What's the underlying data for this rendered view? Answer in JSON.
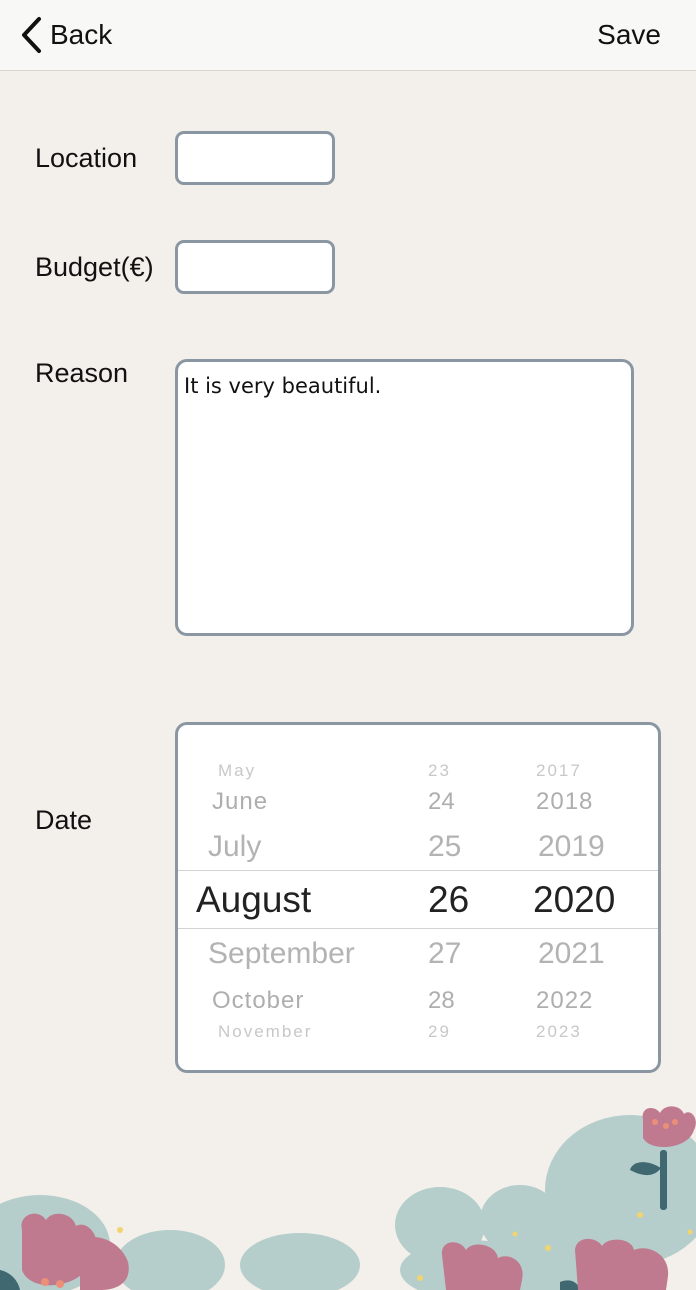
{
  "nav": {
    "back_label": "Back",
    "save_label": "Save"
  },
  "form": {
    "location_label": "Location",
    "location_value": "",
    "budget_label": "Budget(€)",
    "budget_value": "",
    "reason_label": "Reason",
    "reason_value": "It is very beautiful.",
    "date_label": "Date"
  },
  "date_picker": {
    "months": [
      "May",
      "June",
      "July",
      "August",
      "September",
      "October",
      "November"
    ],
    "days": [
      "23",
      "24",
      "25",
      "26",
      "27",
      "28",
      "29"
    ],
    "years": [
      "2017",
      "2018",
      "2019",
      "2020",
      "2021",
      "2022",
      "2023"
    ],
    "selected": {
      "month": "August",
      "day": "26",
      "year": "2020"
    }
  },
  "colors": {
    "background": "#f3efea",
    "field_border": "#8a97a3",
    "foliage": "#b5cecb",
    "flower": "#c07a8f",
    "stem": "#3f6870",
    "dot": "#f2d46e"
  }
}
